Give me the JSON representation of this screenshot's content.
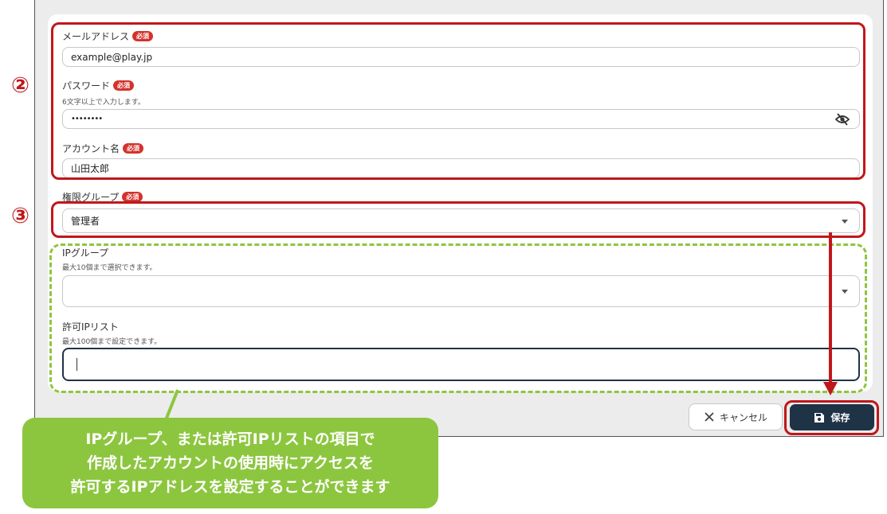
{
  "form": {
    "email": {
      "label": "メールアドレス",
      "required": "必須",
      "value": "example@play.jp"
    },
    "password": {
      "label": "パスワード",
      "required": "必須",
      "hint": "6文字以上で入力します。",
      "value": "••••••••",
      "icon": "eye-off-icon"
    },
    "account": {
      "label": "アカウント名",
      "required": "必須",
      "value": "山田太郎"
    },
    "role": {
      "label": "権限グループ",
      "required": "必須",
      "value": "管理者"
    },
    "ip_group": {
      "label": "IPグループ",
      "hint": "最大10個まで選択できます。",
      "value": ""
    },
    "allowed_ip": {
      "label": "許可IPリスト",
      "hint": "最大100個まで設定できます。",
      "value": ""
    }
  },
  "buttons": {
    "cancel": "キャンセル",
    "save": "保存"
  },
  "annotations": {
    "marker2": "②",
    "marker3": "③",
    "callout": [
      "IPグループ、または許可IPリストの項目で",
      "作成したアカウントの使用時にアクセスを",
      "許可するIPアドレスを設定することができます"
    ]
  },
  "colors": {
    "annotation_red": "#c0171b",
    "callout_green": "#8cc63f",
    "required_badge": "#d4322c",
    "primary_button": "#1f3347"
  }
}
